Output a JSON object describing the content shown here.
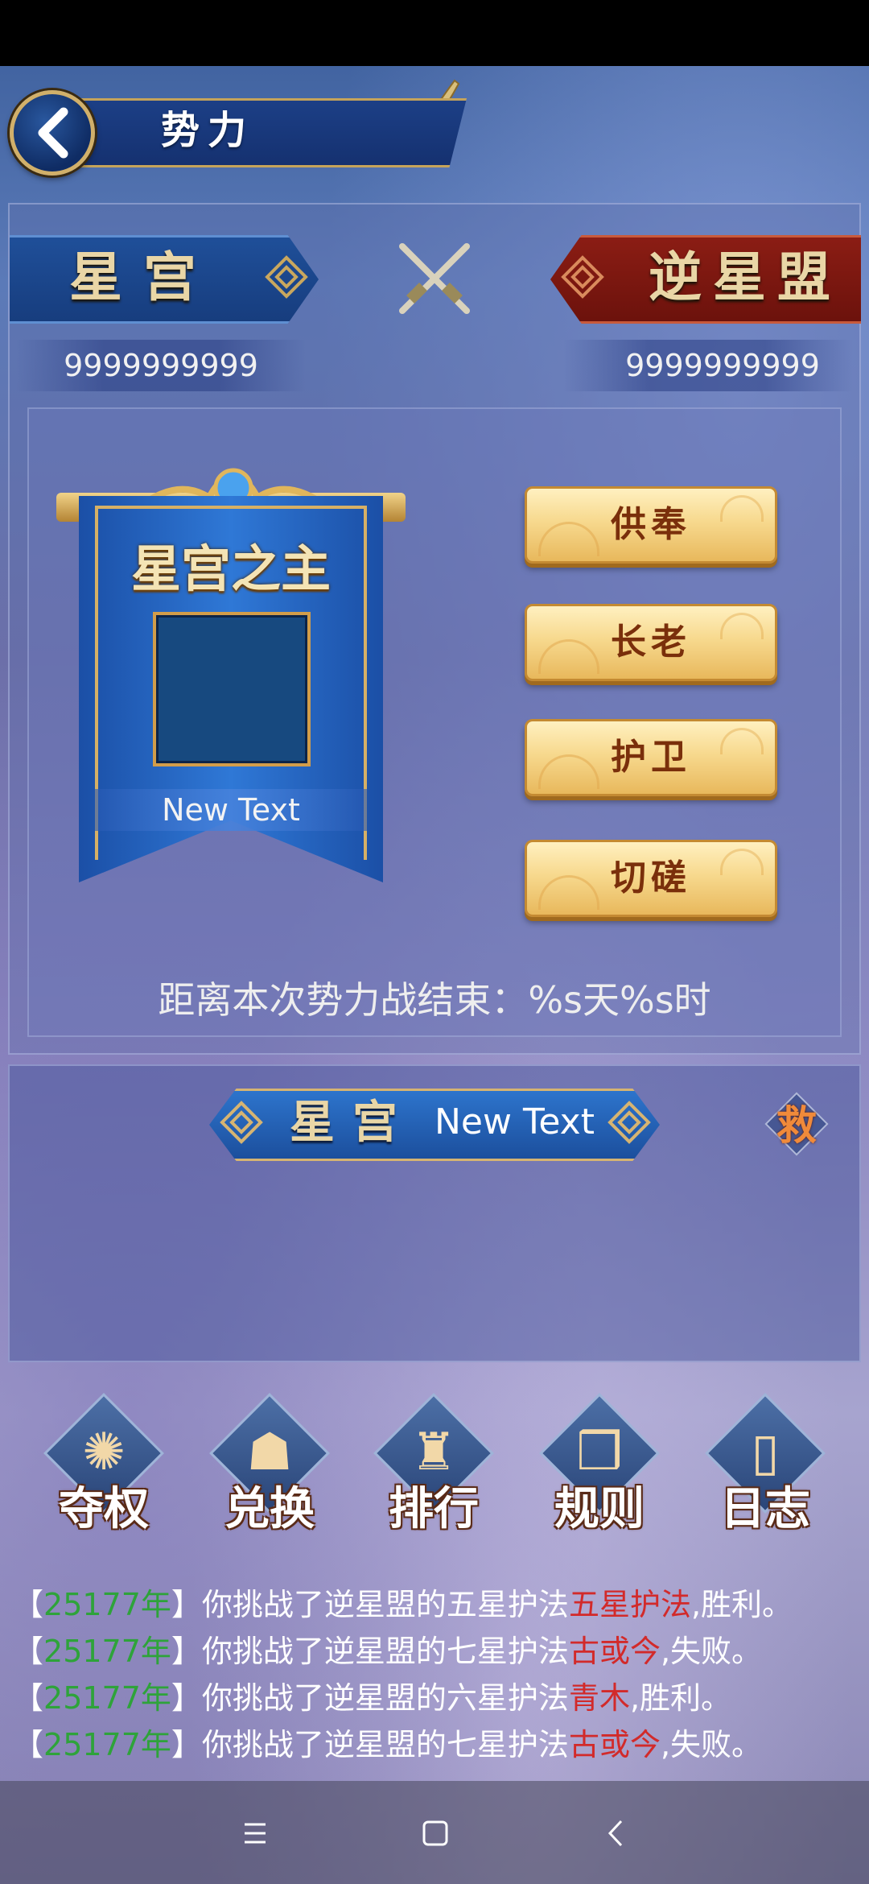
{
  "header": {
    "title": "势力"
  },
  "teams": {
    "left": {
      "name": "星宫",
      "score": "9999999999",
      "color": "#1f4f99"
    },
    "right": {
      "name": "逆星盟",
      "score": "9999999999",
      "color": "#8b1d14"
    }
  },
  "banner": {
    "title": "星宫之主",
    "name": "New Text"
  },
  "buttons": [
    {
      "label": "供奉"
    },
    {
      "label": "长老"
    },
    {
      "label": "护卫"
    },
    {
      "label": "切磋"
    }
  ],
  "countdown": "距离本次势力战结束：%s天%s时",
  "sub_panel": {
    "team": "星宫",
    "text": "New Text",
    "icon": "save-icon",
    "icon_label": "救"
  },
  "actions": [
    {
      "label": "夺权",
      "icon": "flame-orb-icon",
      "glyph": "✺"
    },
    {
      "label": "兑换",
      "icon": "money-bag-icon",
      "glyph": "☗"
    },
    {
      "label": "排行",
      "icon": "ranking-drum-icon",
      "glyph": "♜"
    },
    {
      "label": "规则",
      "icon": "rule-scroll-icon",
      "glyph": "❒"
    },
    {
      "label": "日志",
      "icon": "log-scroll-icon",
      "glyph": "▯"
    }
  ],
  "log": [
    {
      "year": "25177年",
      "text": "你挑战了逆星盟的五星护法",
      "name": "五星护法",
      "result": ",胜利。"
    },
    {
      "year": "25177年",
      "text": "你挑战了逆星盟的七星护法",
      "name": "古或今",
      "result": ",失败。"
    },
    {
      "year": "25177年",
      "text": "你挑战了逆星盟的六星护法",
      "name": "青木",
      "result": ",胜利。"
    },
    {
      "year": "25177年",
      "text": "你挑战了逆星盟的七星护法",
      "name": "古或今",
      "result": ",失败。"
    }
  ],
  "colors": {
    "year": "#2ea33a",
    "highlight": "#d22a2a",
    "gold": "#d6b066"
  }
}
